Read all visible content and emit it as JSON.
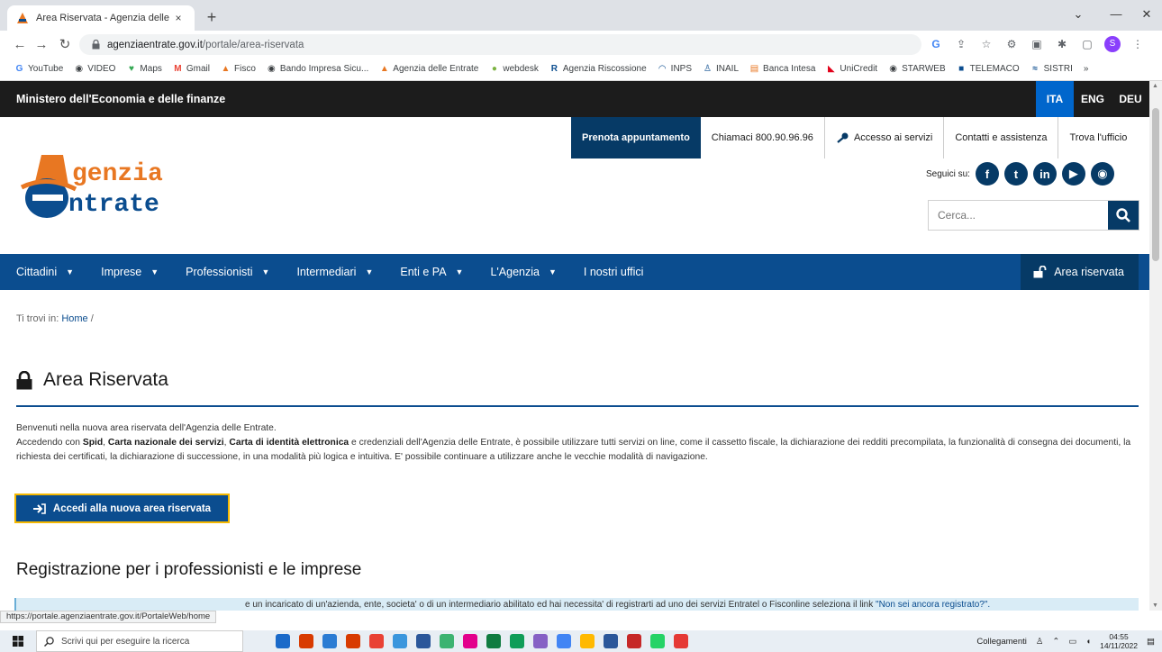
{
  "browser": {
    "tab_title": "Area Riservata - Agenzia delle Fr",
    "tab_close": "×",
    "new_tab": "+",
    "url_host": "agenziaentrate.gov.it",
    "url_path": "/portale/area-riservata",
    "bookmarks": [
      "YouTube",
      "VIDEO",
      "Maps",
      "Gmail",
      "Fisco",
      "Bando Impresa Sicu...",
      "Agenzia delle Entrate",
      "webdesk",
      "Agenzia Riscossione",
      "INPS",
      "INAIL",
      "Banca Intesa",
      "UniCredit",
      "STARWEB",
      "TELEMACO",
      "SISTRI",
      "»"
    ],
    "status_url": "https://portale.agenziaentrate.gov.it/PortaleWeb/home"
  },
  "site": {
    "ministry": "Ministero dell'Economia e delle finanze",
    "languages": [
      "ITA",
      "ENG",
      "DEU"
    ],
    "active_language": "ITA",
    "logo_line1": "genzia",
    "logo_line2": "ntrate",
    "util_links": {
      "prenota": "Prenota appuntamento",
      "chiamaci": "Chiamaci 800.90.96.96",
      "accesso": "Accesso ai servizi",
      "contatti": "Contatti e assistenza",
      "trova": "Trova l'ufficio"
    },
    "social_label": "Seguici su:",
    "search_placeholder": "Cerca...",
    "nav": {
      "cittadini": "Cittadini",
      "imprese": "Imprese",
      "professionisti": "Professionisti",
      "intermediari": "Intermediari",
      "enti": "Enti e PA",
      "agenzia": "L'Agenzia",
      "uffici": "I nostri uffici",
      "area": "Area riservata"
    }
  },
  "content": {
    "breadcrumb_prefix": "Ti trovi in:",
    "breadcrumb_home": "Home",
    "breadcrumb_sep": "/",
    "title": "Area Riservata",
    "intro_line1": "Benvenuti nella nuova area riservata dell'Agenzia delle Entrate.",
    "intro_p2a": "Accedendo con ",
    "intro_spid": "Spid",
    "intro_comma1": ", ",
    "intro_cns": "Carta nazionale dei servizi",
    "intro_comma2": ", ",
    "intro_cie": "Carta di identità elettronica",
    "intro_p2b": " e credenziali dell'Agenzia delle Entrate, è possibile utilizzare tutti servizi on line, come il cassetto fiscale, la dichiarazione dei redditi precompilata, la funzionalità di consegna dei documenti, la richiesta dei certificati, la dichiarazione di successione, in una modalità più logica e intuitiva. E' possibile continuare a utilizzare anche le vecchie modalità di navigazione.",
    "button_accedi": "Accedi alla nuova area riservata",
    "reg_title": "Registrazione per i professionisti e le imprese",
    "info_text": "e un incaricato di un'azienda, ente, societa' o di un intermediario abilitato ed hai necessita' di registrarti ad uno dei servizi Entratel o Fisconline seleziona il link ",
    "info_link": "\"Non sei ancora registrato?\"."
  },
  "taskbar": {
    "search_placeholder": "Scrivi qui per eseguire la ricerca",
    "links_label": "Collegamenti",
    "time": "04:55",
    "date": "14/11/2022",
    "app_colors": [
      "#1b6ac9",
      "#d83b01",
      "#2b7cd3",
      "#d83b01",
      "#e94235",
      "#3a96dd",
      "#2b579a",
      "#3cb371",
      "#e3008c",
      "#107c41",
      "#0f9d58",
      "#8661c5",
      "#4285f4",
      "#ffb900",
      "#2b579a",
      "#c62828",
      "#25d366",
      "#e53935"
    ]
  }
}
